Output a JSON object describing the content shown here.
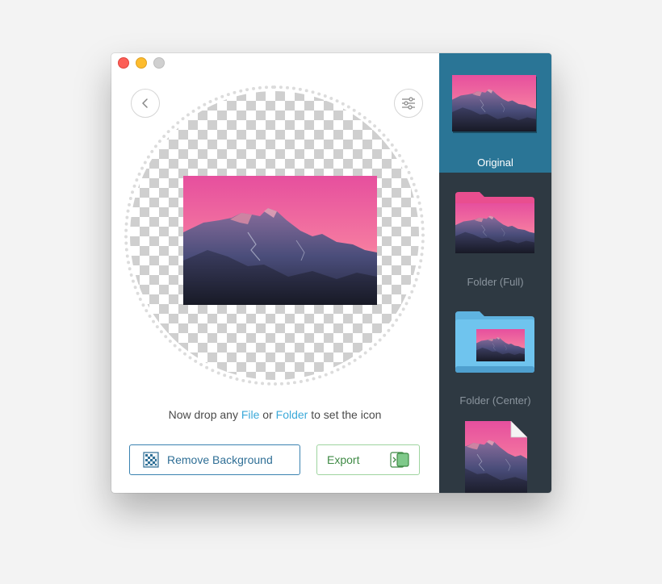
{
  "toolbar": {
    "back_icon": "chevron-left-icon",
    "settings_icon": "sliders-icon"
  },
  "drop_prompt": {
    "before": "Now drop any ",
    "file_link": "File",
    "middle": " or ",
    "folder_link": "Folder",
    "after": " to set the icon"
  },
  "actions": {
    "remove_background_label": "Remove Background",
    "export_label": "Export"
  },
  "sidebar": {
    "items": [
      {
        "label": "Original",
        "selected": true
      },
      {
        "label": "Folder (Full)",
        "selected": false
      },
      {
        "label": "Folder (Center)",
        "selected": false
      },
      {
        "label": "",
        "selected": false
      }
    ]
  },
  "colors": {
    "accent_link": "#3ba9d9",
    "sidebar_bg": "#2e3942",
    "sidebar_selected": "#2a7596",
    "remove_button_border": "#3a82b0",
    "export_button_border": "#9ed49f",
    "folder_blue": "#6fc4ee",
    "folder_pink": "#e94e8f"
  }
}
